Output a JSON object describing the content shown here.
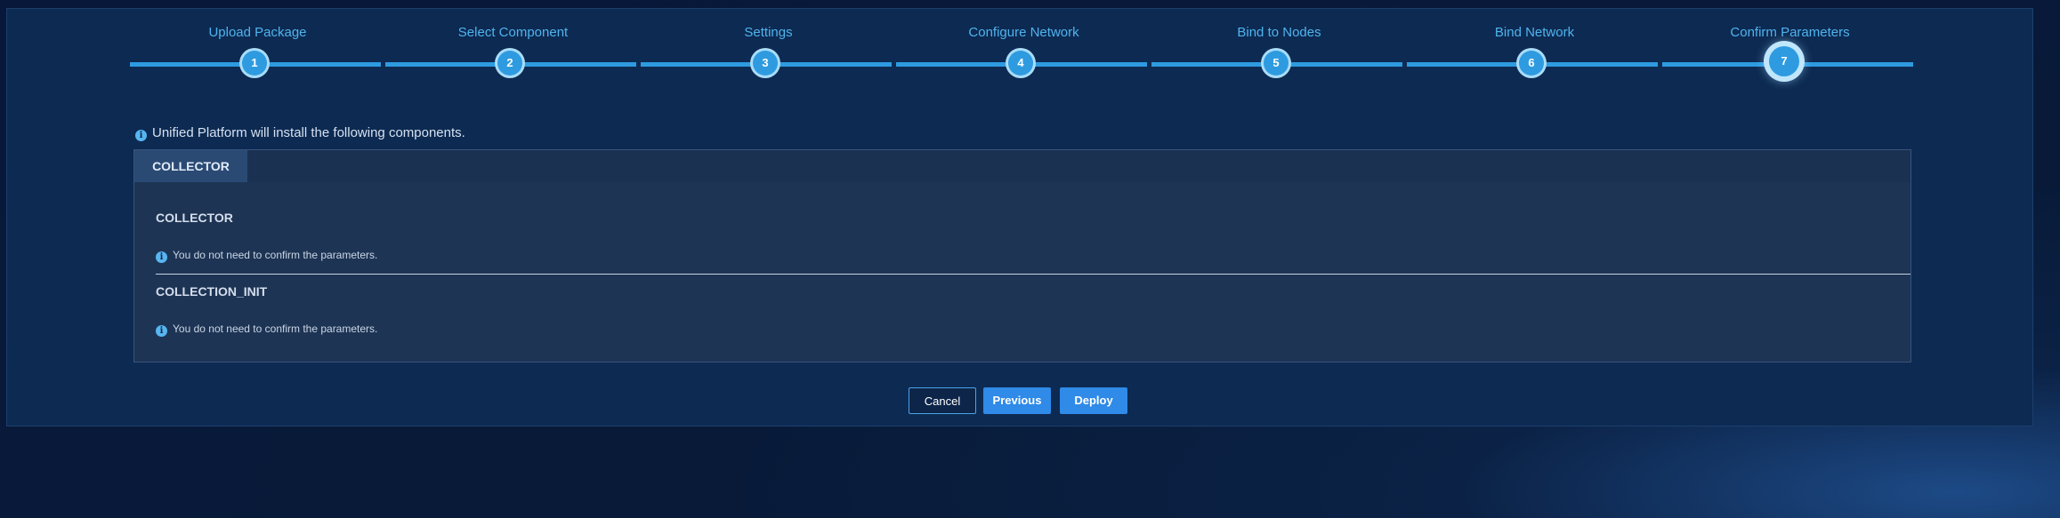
{
  "stepper": {
    "steps": [
      {
        "number": "1",
        "label": "Upload Package"
      },
      {
        "number": "2",
        "label": "Select Component"
      },
      {
        "number": "3",
        "label": "Settings"
      },
      {
        "number": "4",
        "label": "Configure Network"
      },
      {
        "number": "5",
        "label": "Bind to Nodes"
      },
      {
        "number": "6",
        "label": "Bind Network"
      },
      {
        "number": "7",
        "label": "Confirm Parameters"
      }
    ],
    "active_step": "7"
  },
  "info": {
    "text": "Unified Platform will install the following components."
  },
  "components": {
    "tab_label": "COLLECTOR",
    "sections": [
      {
        "title": "COLLECTOR",
        "note": "You do not need to confirm the parameters."
      },
      {
        "title": "COLLECTION_INIT",
        "note": "You do not need to confirm the parameters."
      }
    ]
  },
  "actions": {
    "cancel_label": "Cancel",
    "previous_label": "Previous",
    "deploy_label": "Deploy"
  },
  "colors": {
    "accent": "#2e9be0",
    "button_primary": "#2f8ae8",
    "panel_bg": "#0d2a52"
  }
}
